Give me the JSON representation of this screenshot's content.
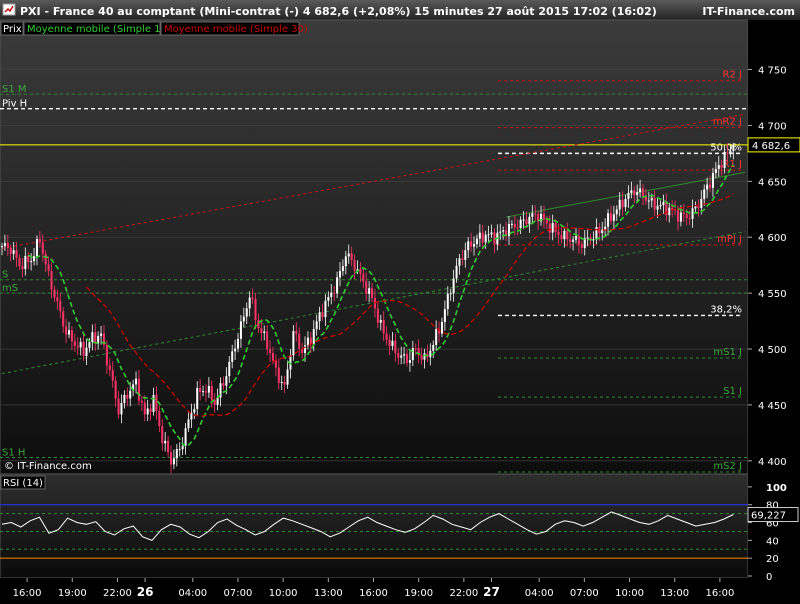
{
  "header": {
    "title": "PXI - France 40 au comptant (Mini-contrat  (-)   4 682,6 (+2,08%)     15 minutes  27 août 2015 17:02 (16:02)",
    "brand": "IT-Finance.com"
  },
  "legend": {
    "price": "Prix",
    "ma10": "Moyenne mobile (Simple 10)",
    "ma30": "Moyenne mobile (Simple 30)"
  },
  "watermark": "© IT-Finance.com",
  "colors": {
    "background": "#000000",
    "candle_up": "#ffffff",
    "candle_down": "#ff3366",
    "ma10": "#33cc33",
    "ma30": "#cc0000",
    "last_price_line": "#ffff00",
    "rsi_line": "#ffffff",
    "rsi_upper_band": "#2233ff",
    "rsi_lower_band": "#ff8800"
  },
  "chart_data": [
    {
      "type": "candlestick",
      "title": "PXI - France 40 au comptant (Mini-contrat  (-)",
      "interval": "15 minutes",
      "y_ticks": [
        "4 750",
        "4 700",
        "4 650",
        "4 600",
        "4 550",
        "4 500",
        "4 450",
        "4 400"
      ],
      "ylim": [
        4390,
        4780
      ],
      "last_value": 4682.6,
      "last_value_label": "4 682,6",
      "x_ticks": [
        "16:00",
        "19:00",
        "22:00",
        "26",
        "04:00",
        "07:00",
        "10:00",
        "13:00",
        "16:00",
        "19:00",
        "22:00",
        "27",
        "04:00",
        "07:00",
        "10:00",
        "13:00",
        "16:00"
      ],
      "close_path": [
        [
          0,
          4592
        ],
        [
          3,
          4590
        ],
        [
          6,
          4575
        ],
        [
          10,
          4580
        ],
        [
          13,
          4598
        ],
        [
          16,
          4565
        ],
        [
          19,
          4540
        ],
        [
          22,
          4515
        ],
        [
          25,
          4505
        ],
        [
          28,
          4498
        ],
        [
          31,
          4510
        ],
        [
          34,
          4512
        ],
        [
          37,
          4480
        ],
        [
          40,
          4445
        ],
        [
          43,
          4460
        ],
        [
          46,
          4470
        ],
        [
          49,
          4440
        ],
        [
          52,
          4455
        ],
        [
          55,
          4420
        ],
        [
          58,
          4400
        ],
        [
          61,
          4410
        ],
        [
          64,
          4435
        ],
        [
          67,
          4460
        ],
        [
          70,
          4465
        ],
        [
          73,
          4452
        ],
        [
          76,
          4470
        ],
        [
          79,
          4495
        ],
        [
          82,
          4520
        ],
        [
          85,
          4548
        ],
        [
          88,
          4520
        ],
        [
          91,
          4505
        ],
        [
          94,
          4480
        ],
        [
          97,
          4465
        ],
        [
          100,
          4515
        ],
        [
          103,
          4498
        ],
        [
          106,
          4510
        ],
        [
          109,
          4530
        ],
        [
          112,
          4545
        ],
        [
          115,
          4560
        ],
        [
          118,
          4585
        ],
        [
          121,
          4575
        ],
        [
          124,
          4560
        ],
        [
          127,
          4545
        ],
        [
          130,
          4520
        ],
        [
          133,
          4505
        ],
        [
          136,
          4495
        ],
        [
          139,
          4490
        ],
        [
          142,
          4500
        ],
        [
          145,
          4490
        ],
        [
          148,
          4505
        ],
        [
          151,
          4525
        ],
        [
          154,
          4555
        ],
        [
          157,
          4580
        ],
        [
          160,
          4592
        ],
        [
          163,
          4598
        ],
        [
          166,
          4602
        ],
        [
          169,
          4600
        ],
        [
          172,
          4605
        ],
        [
          175,
          4610
        ],
        [
          178,
          4612
        ],
        [
          181,
          4618
        ],
        [
          184,
          4620
        ],
        [
          187,
          4612
        ],
        [
          190,
          4605
        ],
        [
          193,
          4600
        ],
        [
          196,
          4598
        ],
        [
          199,
          4594
        ],
        [
          202,
          4600
        ],
        [
          205,
          4605
        ],
        [
          208,
          4615
        ],
        [
          211,
          4625
        ],
        [
          214,
          4635
        ],
        [
          217,
          4642
        ],
        [
          220,
          4638
        ],
        [
          223,
          4630
        ],
        [
          226,
          4628
        ],
        [
          229,
          4625
        ],
        [
          232,
          4620
        ],
        [
          235,
          4618
        ],
        [
          238,
          4625
        ],
        [
          241,
          4640
        ],
        [
          244,
          4655
        ],
        [
          247,
          4668
        ],
        [
          250,
          4678
        ],
        [
          251,
          4682.6
        ]
      ],
      "moving_averages": [
        {
          "name": "Moyenne mobile (Simple 10)",
          "period": 10,
          "color": "#33cc33",
          "style": "dashed"
        },
        {
          "name": "Moyenne mobile (Simple 30)",
          "period": 30,
          "color": "#cc0000",
          "style": "dashed"
        }
      ],
      "pivot_levels": [
        {
          "label": "S1 M",
          "value": 4728,
          "color": "#2e8b2e",
          "side": "left"
        },
        {
          "label": "Piv H",
          "value": 4715,
          "color": "#ffffff",
          "side": "left"
        },
        {
          "label": "R2 J",
          "value": 4740,
          "color": "#cc1111",
          "side": "right"
        },
        {
          "label": "mR2 J",
          "value": 4698,
          "color": "#cc1111",
          "side": "right"
        },
        {
          "label": "50,0%",
          "value": 4675,
          "color": "#ffffff",
          "side": "right"
        },
        {
          "label": "R1 J",
          "value": 4660,
          "color": "#cc1111",
          "side": "right"
        },
        {
          "label": "mPJ J",
          "value": 4593,
          "color": "#cc1111",
          "side": "right"
        },
        {
          "label": "mS",
          "value": 4550,
          "color": "#2e8b2e",
          "side": "left"
        },
        {
          "label": "S",
          "value": 4562,
          "color": "#2e8b2e",
          "side": "left"
        },
        {
          "label": "38,2%",
          "value": 4530,
          "color": "#ffffff",
          "side": "right"
        },
        {
          "label": "mS1 J",
          "value": 4492,
          "color": "#2e8b2e",
          "side": "right"
        },
        {
          "label": "S1 J",
          "value": 4457,
          "color": "#2e8b2e",
          "side": "right"
        },
        {
          "label": "S1 H",
          "value": 4403,
          "color": "#2e8b2e",
          "side": "left"
        },
        {
          "label": "mS2 J",
          "value": 4390,
          "color": "#2e8b2e",
          "side": "right"
        }
      ],
      "trendlines": [
        {
          "color": "#cc1111",
          "from": [
            0,
            4590
          ],
          "to": [
            255,
            4710
          ]
        },
        {
          "color": "#2e8b2e",
          "from": [
            0,
            4478
          ],
          "to": [
            255,
            4605
          ]
        },
        {
          "color": "#2e8b2e",
          "from": [
            173,
            4618
          ],
          "to": [
            255,
            4658
          ]
        }
      ]
    },
    {
      "type": "line",
      "title": "RSI (14)",
      "ylim": [
        0,
        110
      ],
      "y_ticks": [
        "100",
        "80",
        "60",
        "40",
        "20",
        "0"
      ],
      "last_value_label": "69,227",
      "bands": [
        80,
        70,
        50,
        30,
        20
      ],
      "values": [
        58,
        60,
        55,
        62,
        66,
        48,
        52,
        65,
        60,
        58,
        61,
        50,
        46,
        53,
        56,
        44,
        40,
        52,
        58,
        55,
        47,
        43,
        50,
        60,
        64,
        57,
        52,
        46,
        50,
        58,
        65,
        62,
        58,
        54,
        50,
        44,
        48,
        55,
        62,
        66,
        60,
        56,
        52,
        49,
        53,
        60,
        68,
        64,
        58,
        55,
        52,
        60,
        66,
        70,
        64,
        58,
        52,
        47,
        50,
        58,
        62,
        60,
        56,
        60,
        66,
        72,
        68,
        64,
        60,
        58,
        62,
        68,
        64,
        60,
        56,
        58,
        60,
        64,
        69
      ]
    }
  ]
}
